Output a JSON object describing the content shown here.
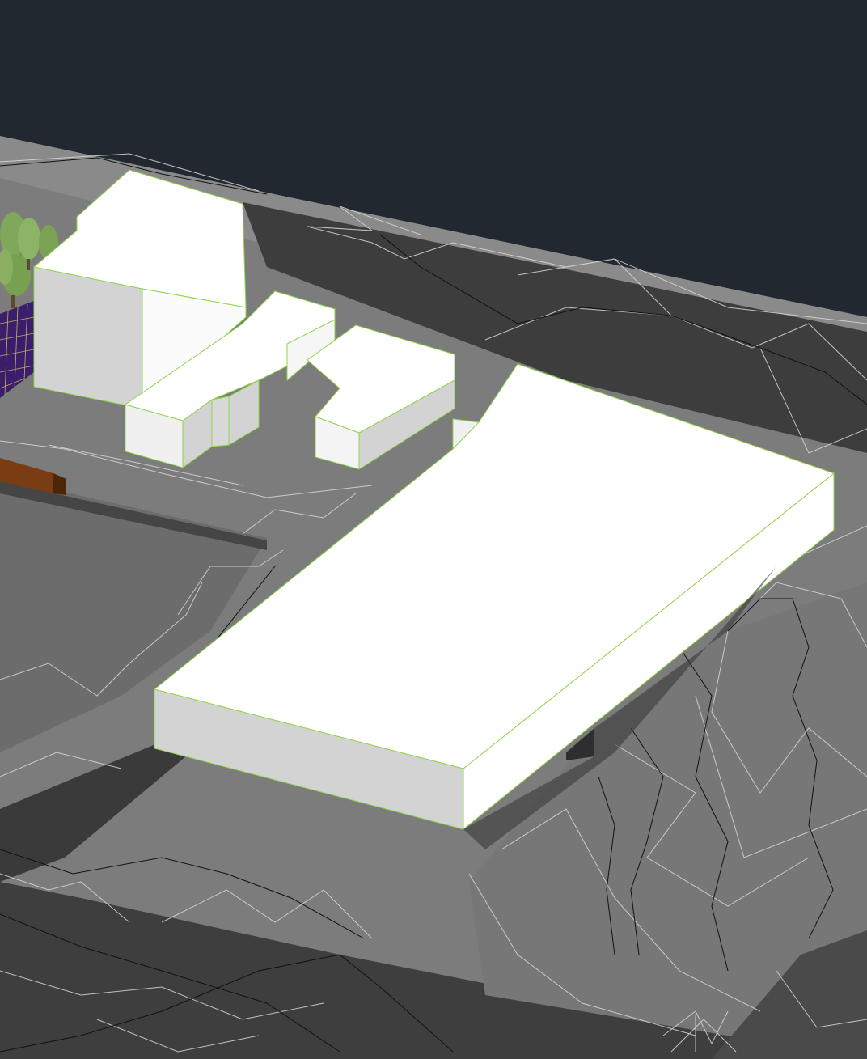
{
  "viewport": {
    "visual_style": "shaded",
    "background_color": "#212830"
  },
  "colors": {
    "terrain_light": "#7c7c7c",
    "terrain_mid": "#6a6a6a",
    "terrain_dark": "#3d3d3d",
    "mesh_edge": "#d9d9d9",
    "contour_line": "#111111",
    "building_top": "#ffffff",
    "building_side": "#d3d3d3",
    "building_edge": "#8fd44a",
    "tree_foliage": "#7fa85a",
    "grid_surface": "#3a1d6b",
    "grid_line": "#e8d36a",
    "brown_block": "#7a3c12"
  },
  "objects": {
    "terrain": "terrain-surface",
    "roads": [
      "road-band-north",
      "road-band-south",
      "driveway"
    ],
    "buildings": [
      "tower-block",
      "annex-block",
      "small-block",
      "large-warehouse"
    ],
    "trees": "tree-cluster",
    "grid": "paving-grid"
  }
}
